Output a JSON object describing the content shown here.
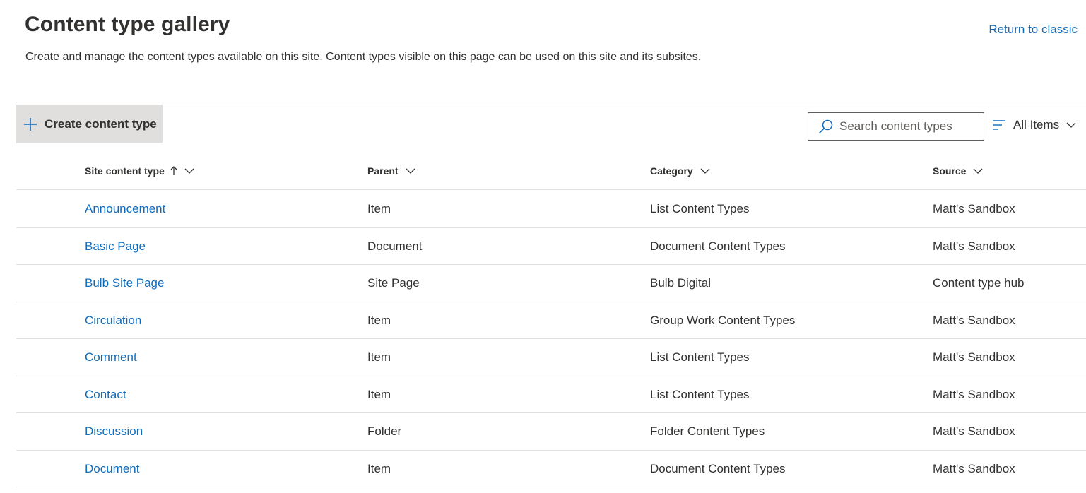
{
  "page": {
    "title": "Content type gallery",
    "return_link": "Return to classic",
    "description": "Create and manage the content types available on this site. Content types visible on this page can be used on this site and its subsites."
  },
  "toolbar": {
    "create_label": "Create content type",
    "search_placeholder": "Search content types",
    "view_label": "All Items"
  },
  "table": {
    "columns": [
      "Site content type",
      "Parent",
      "Category",
      "Source"
    ],
    "sorted_column": "Site content type",
    "sort_direction": "ascending",
    "rows": [
      [
        "Announcement",
        "Item",
        "List Content Types",
        "Matt's Sandbox"
      ],
      [
        "Basic Page",
        "Document",
        "Document Content Types",
        "Matt's Sandbox"
      ],
      [
        "Bulb Site Page",
        "Site Page",
        "Bulb Digital",
        "Content type hub"
      ],
      [
        "Circulation",
        "Item",
        "Group Work Content Types",
        "Matt's Sandbox"
      ],
      [
        "Comment",
        "Item",
        "List Content Types",
        "Matt's Sandbox"
      ],
      [
        "Contact",
        "Item",
        "List Content Types",
        "Matt's Sandbox"
      ],
      [
        "Discussion",
        "Folder",
        "Folder Content Types",
        "Matt's Sandbox"
      ],
      [
        "Document",
        "Item",
        "Document Content Types",
        "Matt's Sandbox"
      ]
    ]
  },
  "colors": {
    "link": "#0f6cbd",
    "text": "#323130",
    "button_bg": "#e1dfdd",
    "divider": "#e1dfdd"
  },
  "icons": {
    "create": "plus-icon",
    "search": "search-icon",
    "view": "filter-icon",
    "dropdown": "chevron-down-icon",
    "sort": "arrow-up-icon"
  }
}
